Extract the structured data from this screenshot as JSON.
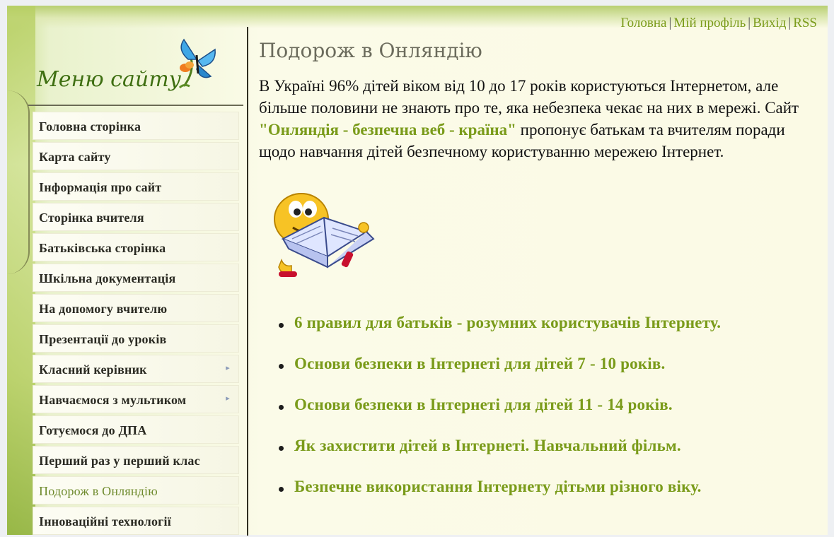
{
  "top_nav": {
    "home": "Головна",
    "profile": "Мій профіль",
    "logout": "Вихід",
    "rss": "RSS"
  },
  "sidebar": {
    "title": "Меню сайту",
    "items": [
      {
        "label": "Головна сторінка"
      },
      {
        "label": "Карта сайту"
      },
      {
        "label": "Інформація про сайт"
      },
      {
        "label": "Сторінка вчителя"
      },
      {
        "label": "Батьківська сторінка"
      },
      {
        "label": "Шкільна документація"
      },
      {
        "label": "На допомогу вчителю"
      },
      {
        "label": "Презентації до уроків"
      },
      {
        "label": "Класний керівник"
      },
      {
        "label": "Навчаємося з мультиком"
      },
      {
        "label": "Готуємося до ДПА"
      },
      {
        "label": "Перший раз у перший клас"
      },
      {
        "label": "Подорож в Онляндію"
      },
      {
        "label": "Інноваційні технології"
      }
    ]
  },
  "main": {
    "title": "Подорож в Онляндію",
    "intro_before": " В Україні 96% дітей віком від 10 до 17 років користуються Інтернетом, але більше половини не знають про те, яка небезпека чекає на них в мережі. Сайт ",
    "intro_highlight": "\"Онляндія - безпечна веб - країна\"",
    "intro_after": " пропонує батькам та вчителям поради щодо навчання дітей безпечному користуванню мережею Інтернет.",
    "links": [
      "6 правил для батьків - розумних користувачів Інтернету.",
      "Основи безпеки в Інтернеті для дітей 7 - 10 років.",
      "Основи безпеки в Інтернеті для дітей 11 - 14 років.",
      "Як захистити дітей в Інтернеті. Навчальний фільм.",
      "Безпечне використання Інтернету дітьми різного віку."
    ]
  },
  "colors": {
    "link_green": "#7a9b1a",
    "menu_title_green": "#3f6f12"
  }
}
